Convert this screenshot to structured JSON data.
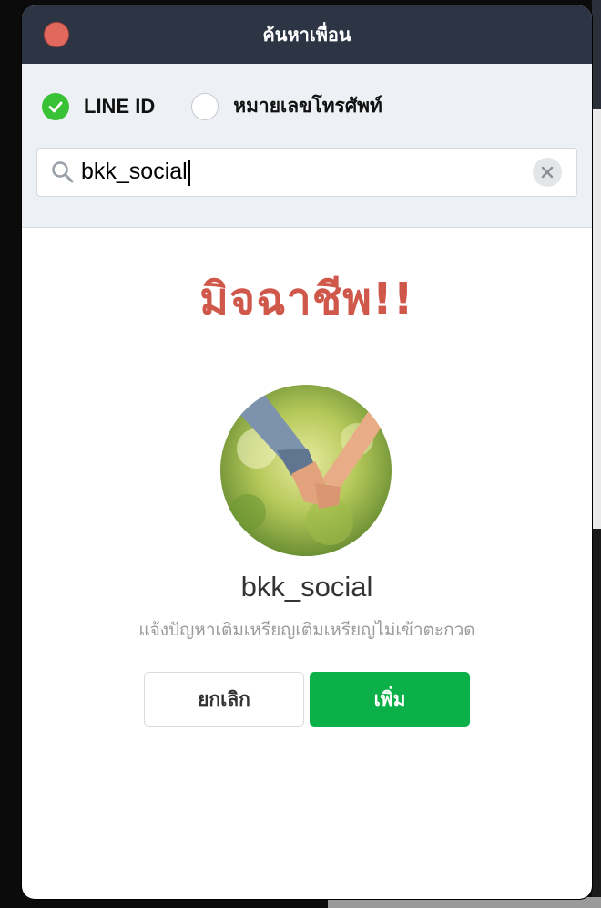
{
  "window": {
    "title": "ค้นหาเพื่อน"
  },
  "search_type": {
    "options": [
      {
        "label": "LINE ID",
        "selected": true
      },
      {
        "label": "หมายเลขโทรศัพท์",
        "selected": false
      }
    ]
  },
  "search": {
    "value": "bkk_social",
    "icon": "search-icon"
  },
  "result": {
    "warning": "มิจฉาชีพ!!",
    "username": "bkk_social",
    "status_message": "แจ้งปัญหาเติมเหรียญเติมเหรียญไม่เข้าตะกวด"
  },
  "actions": {
    "cancel_label": "ยกเลิก",
    "add_label": "เพิ่ม"
  },
  "colors": {
    "titlebar": "#2d3444",
    "accent_green": "#0bb148",
    "radio_green": "#39c236",
    "warning_red": "#d0584b",
    "close_red": "#e0685d"
  }
}
